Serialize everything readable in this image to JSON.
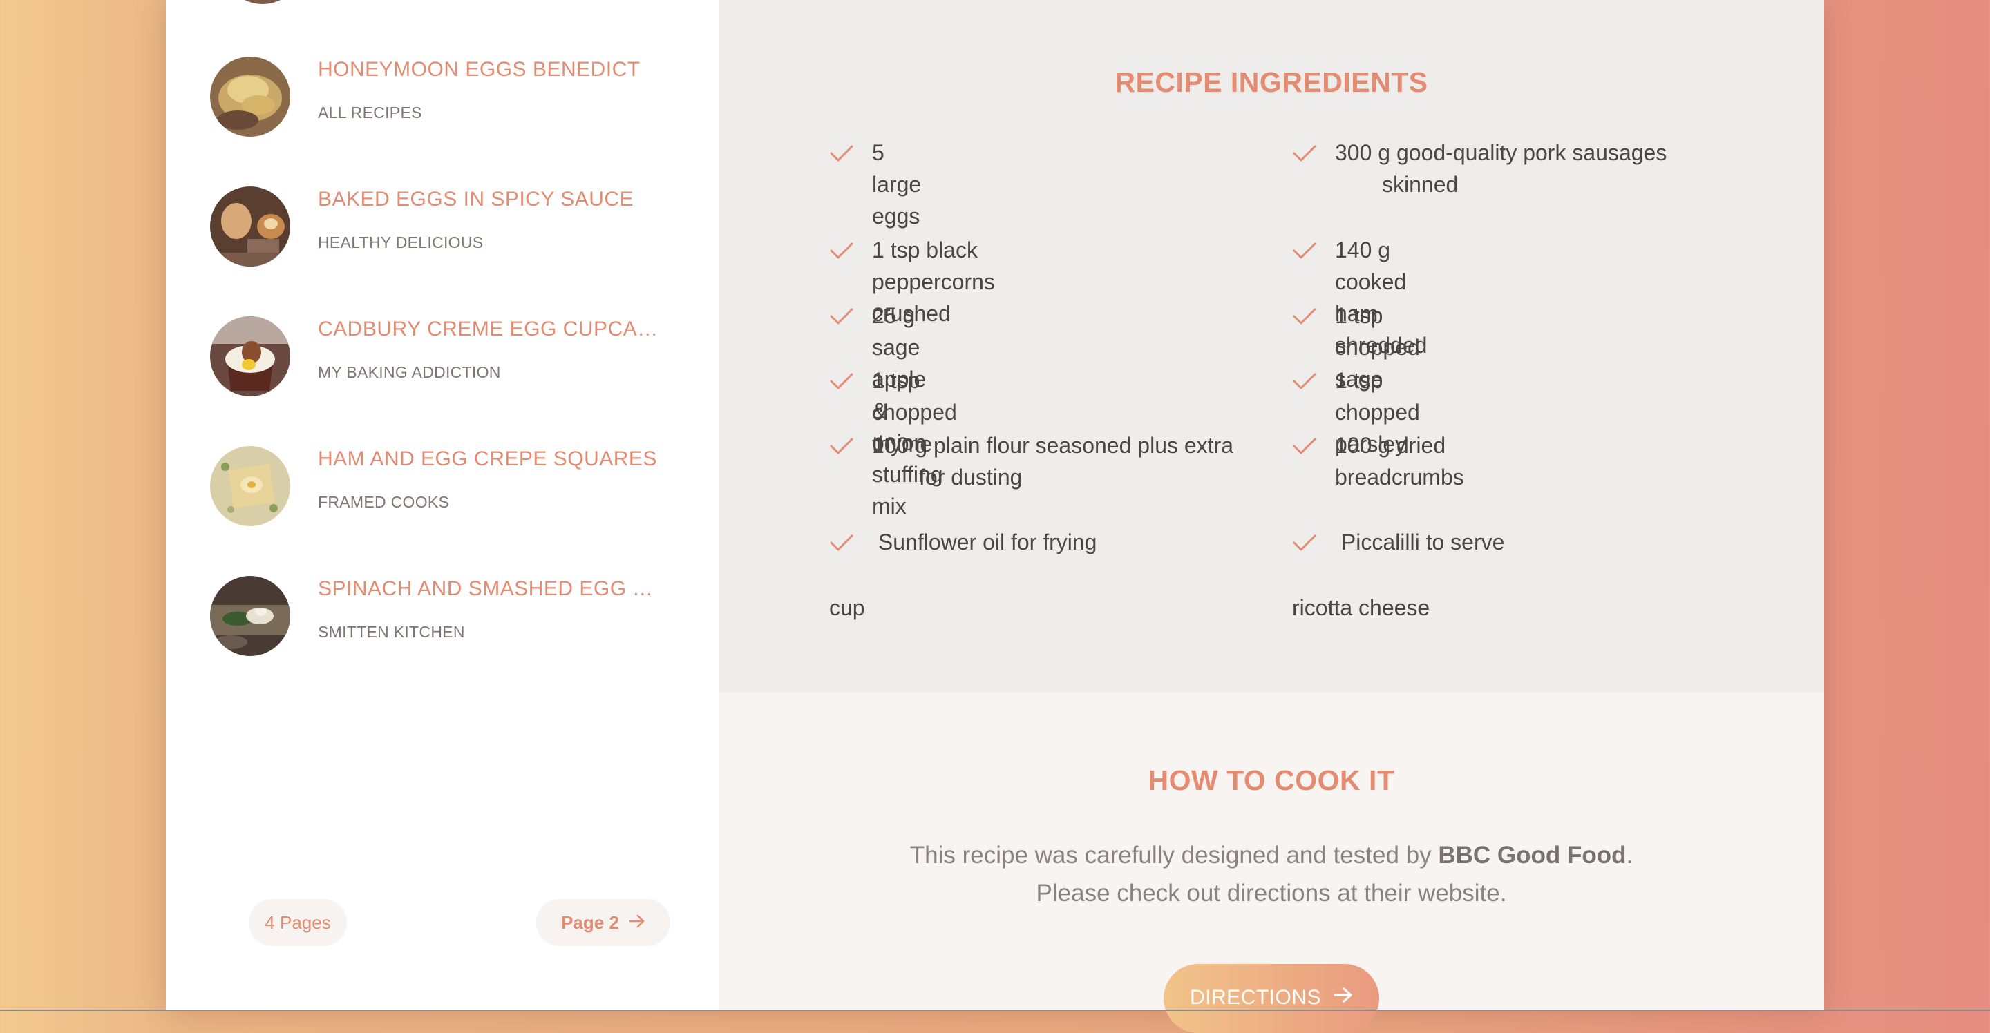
{
  "sidebar": {
    "recipes": [
      {
        "title": "HONEYMOON EGGS BENEDICT",
        "source": "ALL RECIPES"
      },
      {
        "title": "BAKED EGGS IN SPICY SAUCE",
        "source": "HEALTHY DELICIOUS"
      },
      {
        "title": "CADBURY CREME EGG CUPCAKES",
        "source": "MY BAKING ADDICTION"
      },
      {
        "title": "HAM AND EGG CREPE SQUARES",
        "source": "FRAMED COOKS"
      },
      {
        "title": "SPINACH AND SMASHED EGG TO...",
        "source": "SMITTEN KITCHEN"
      }
    ],
    "pagination": {
      "pages_label": "4 Pages",
      "next_label": "Page 2"
    }
  },
  "ingredients": {
    "title": "RECIPE INGREDIENTS",
    "items": [
      {
        "line1": "5 large eggs",
        "line2": ""
      },
      {
        "line1": "300 g good-quality pork sausages",
        "line2": "skinned"
      },
      {
        "line1": "1 tsp black peppercorns crushed",
        "line2": ""
      },
      {
        "line1": "140 g cooked ham shredded",
        "line2": ""
      },
      {
        "line1": "25 g sage apple & onion stuffing mix",
        "line2": ""
      },
      {
        "line1": "1 tsp chopped sage",
        "line2": ""
      },
      {
        "line1": "1 tsp chopped thyme",
        "line2": ""
      },
      {
        "line1": "1 tsp chopped parsley",
        "line2": ""
      },
      {
        "line1": "100 g plain flour seasoned plus extra",
        "line2": "for dusting"
      },
      {
        "line1": "100 g dried breadcrumbs",
        "line2": ""
      },
      {
        "line1": " Sunflower oil for frying",
        "line2": ""
      },
      {
        "line1": " Piccalilli to serve",
        "line2": ""
      }
    ],
    "extras": [
      "cup",
      "ricotta cheese"
    ]
  },
  "howto": {
    "title": "HOW TO COOK IT",
    "text_before": "This recipe was carefully designed and tested by ",
    "source_bold": "BBC Good Food",
    "text_after": ". Please check out directions at their website.",
    "button_label": "DIRECTIONS"
  },
  "colors": {
    "accent": "#e48c72",
    "panel": "#efedeb",
    "howto_bg": "#f7f4f1"
  },
  "icons": [
    "check-icon",
    "arrow-right-icon"
  ]
}
